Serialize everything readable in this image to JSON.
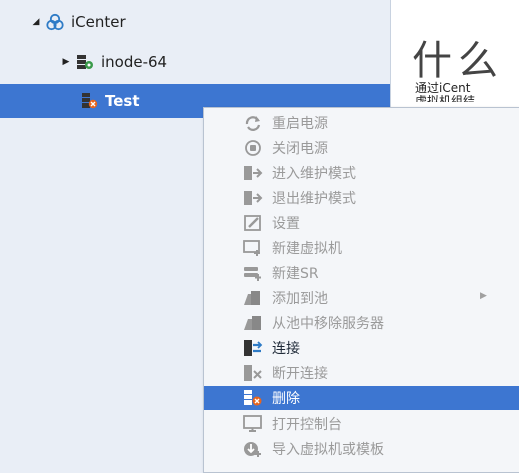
{
  "tree": {
    "items": [
      {
        "label": "iCenter",
        "icon": "cluster-icon"
      },
      {
        "label": "inode-64",
        "icon": "server-pool-icon"
      },
      {
        "label": "Test",
        "icon": "host-error-icon"
      }
    ]
  },
  "content": {
    "title": "什么",
    "desc_line1": "通过iCent",
    "desc_line2": "虚拟机组结"
  },
  "context_menu": {
    "items": [
      {
        "label": "重启电源",
        "icon": "restart-icon",
        "enabled": false
      },
      {
        "label": "关闭电源",
        "icon": "power-off-icon",
        "enabled": false
      },
      {
        "label": "进入维护模式",
        "icon": "enter-maintenance-icon",
        "enabled": false
      },
      {
        "label": "退出维护模式",
        "icon": "exit-maintenance-icon",
        "enabled": false
      },
      {
        "label": "设置",
        "icon": "edit-settings-icon",
        "enabled": false
      },
      {
        "label": "新建虚拟机",
        "icon": "new-vm-icon",
        "enabled": false
      },
      {
        "label": "新建SR",
        "icon": "new-sr-icon",
        "enabled": false
      },
      {
        "label": "添加到池",
        "icon": "add-to-pool-icon",
        "enabled": false,
        "submenu": true
      },
      {
        "label": "从池中移除服务器",
        "icon": "remove-from-pool-icon",
        "enabled": false
      },
      {
        "label": "连接",
        "icon": "connect-icon",
        "enabled": true
      },
      {
        "label": "断开连接",
        "icon": "disconnect-icon",
        "enabled": false
      },
      {
        "label": "删除",
        "icon": "delete-icon",
        "enabled": true,
        "highlighted": true
      },
      {
        "label": "打开控制台",
        "icon": "console-icon",
        "enabled": false
      },
      {
        "label": "导入虚拟机或模板",
        "icon": "import-icon",
        "enabled": false
      }
    ]
  },
  "colors": {
    "selection": "#3d76d1",
    "tree_bg": "#e9eef6",
    "disabled_text": "#9a9a9a"
  }
}
